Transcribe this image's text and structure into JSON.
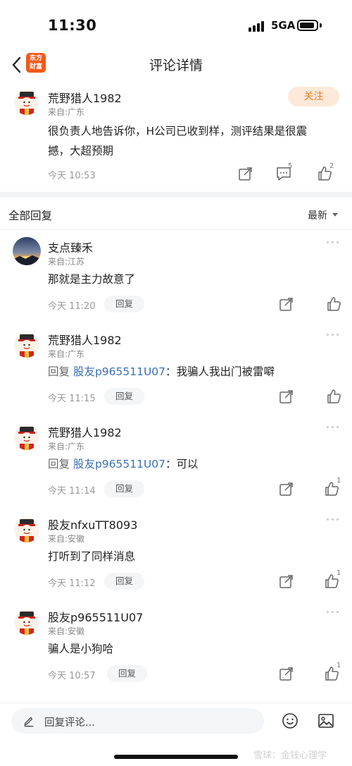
{
  "status_bar": {
    "time": "11:30",
    "network": "5GA"
  },
  "nav": {
    "title": "评论详情",
    "logo_text": "东方财富"
  },
  "main_comment": {
    "author": "荒野猎人1982",
    "location": "来自:广东",
    "follow_label": "关注",
    "text_line1": "很负责人地告诉你，H公司已收到样，测评结果是很震",
    "text_line2": "撼，大超预期",
    "time": "今天 10:53",
    "comment_count": "5",
    "like_count": "2"
  },
  "replies_header": {
    "title": "全部回复",
    "sort": "最新"
  },
  "replies": [
    {
      "author": "支点臻禾",
      "location": "来自:江苏",
      "prefix": "",
      "mention": "",
      "text": "那就是主力故意了",
      "time": "今天 11:20",
      "reply_label": "回复",
      "like_count": "",
      "avatar": "landscape"
    },
    {
      "author": "荒野猎人1982",
      "location": "来自:广东",
      "prefix": "回复",
      "mention": "股友p965511U07",
      "text": "：我骗人我出门被雷噼",
      "time": "今天 11:15",
      "reply_label": "回复",
      "like_count": "",
      "avatar": "mascot"
    },
    {
      "author": "荒野猎人1982",
      "location": "来自:广东",
      "prefix": "回复",
      "mention": "股友p965511U07",
      "text": "：可以",
      "time": "今天 11:14",
      "reply_label": "回复",
      "like_count": "1",
      "avatar": "mascot"
    },
    {
      "author": "股友nfxuTT8093",
      "location": "来自:安徽",
      "prefix": "",
      "mention": "",
      "text": "打听到了同样消息",
      "time": "今天 11:12",
      "reply_label": "回复",
      "like_count": "1",
      "avatar": "mascot"
    },
    {
      "author": "股友p965511U07",
      "location": "来自:安徽",
      "prefix": "",
      "mention": "",
      "text": "骗人是小狗哈",
      "time": "今天 10:57",
      "reply_label": "回复",
      "like_count": "1",
      "avatar": "mascot"
    }
  ],
  "bottom_bar": {
    "placeholder": "回复评论..."
  },
  "watermark": "雪球：金钱心理学",
  "colors": {
    "accent": "#f07a2a",
    "mention": "#3a6fb5",
    "logo": "#f25a1a"
  }
}
